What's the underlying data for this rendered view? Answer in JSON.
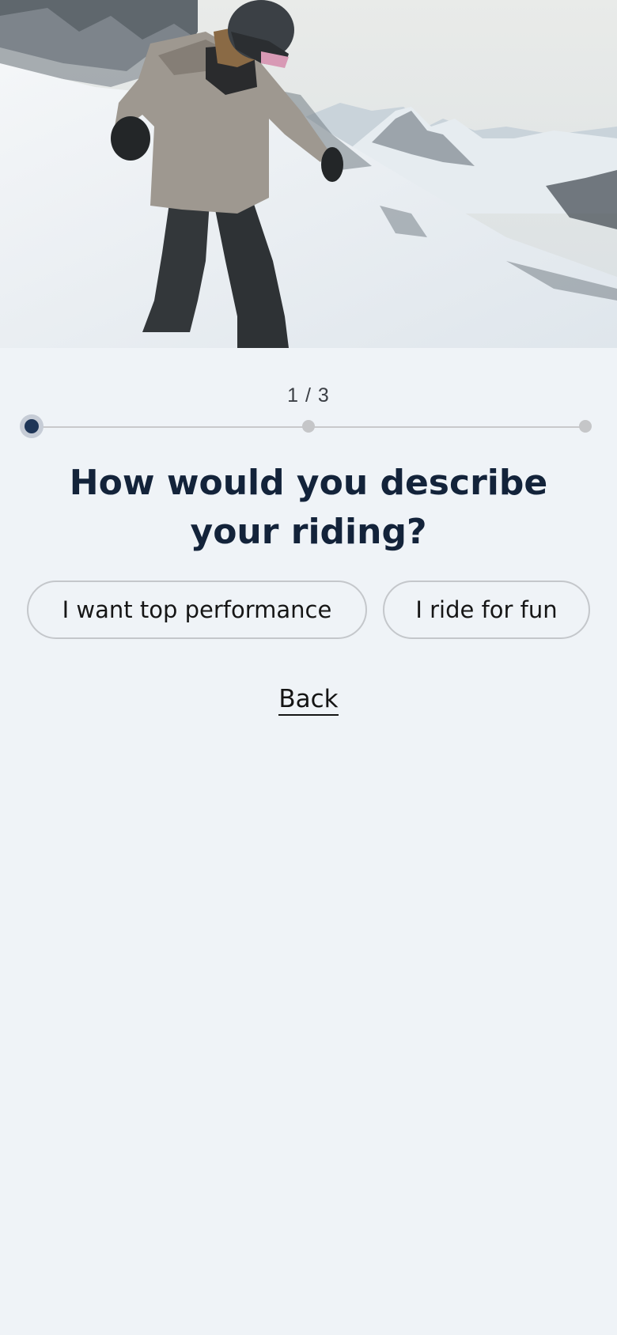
{
  "hero": {
    "image_description_icon": "snowboarder-photo"
  },
  "quiz": {
    "step_counter": "1 / 3",
    "progress": {
      "current": 1,
      "total": 3
    },
    "question": "How would you describe your riding?",
    "options": [
      {
        "label": "I want top performance"
      },
      {
        "label": "I ride for fun"
      }
    ],
    "back_label": "Back"
  },
  "colors": {
    "background": "#eff3f7",
    "heading": "#13233a",
    "progress_active": "#1e3557",
    "progress_inactive": "#c5c6c8",
    "option_border": "#c4c7cb"
  }
}
